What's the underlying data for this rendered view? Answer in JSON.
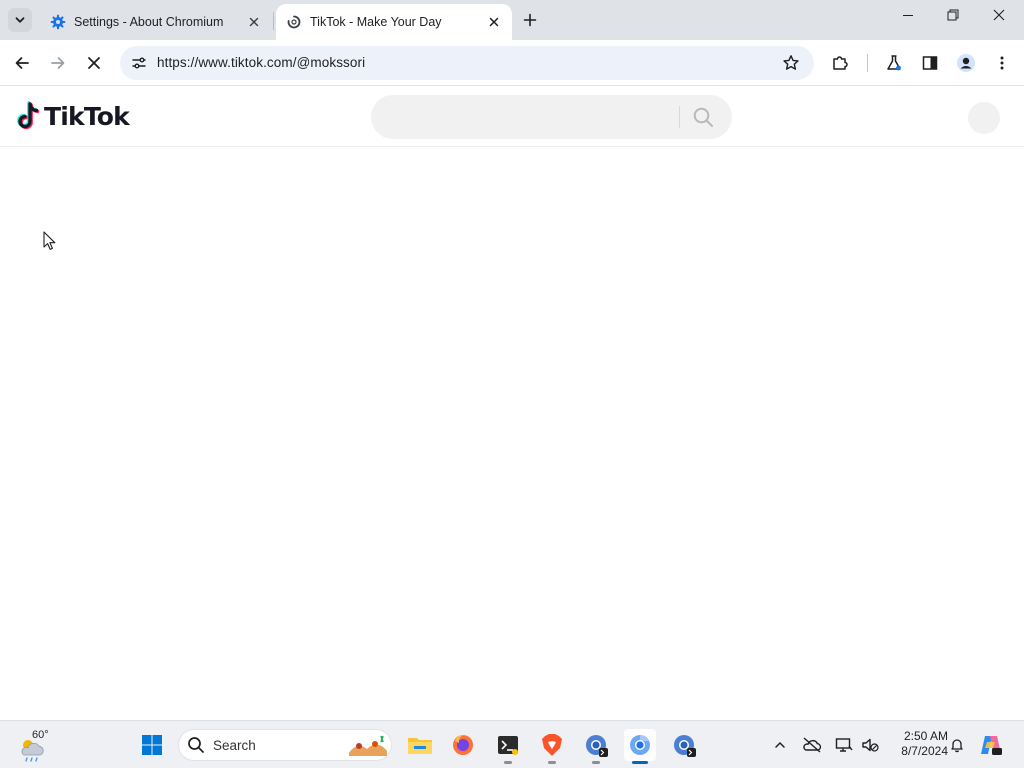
{
  "browser": {
    "tabs": [
      {
        "title": "Settings - About Chromium",
        "favicon": "gear-icon",
        "active": false
      },
      {
        "title": "TikTok - Make Your Day",
        "favicon": "loading-spinner-icon",
        "active": true
      }
    ],
    "address_bar": {
      "url": "https://www.tiktok.com/@mokssori"
    },
    "page_loading": true
  },
  "page": {
    "logo_text": "TikTok",
    "brand_colors": {
      "cyan": "#25f4ee",
      "red": "#fe2c55",
      "dark": "#161823"
    }
  },
  "taskbar": {
    "weather": {
      "temperature": "60°"
    },
    "search": {
      "placeholder": "Search"
    },
    "apps": [
      "start-icon",
      "file-explorer-icon",
      "firefox-icon",
      "terminal-icon",
      "brave-icon",
      "chromium-dev-icon",
      "chromium-icon",
      "chromium-canary-icon"
    ],
    "clock": {
      "time": "2:50 AM",
      "date": "8/7/2024"
    },
    "accent_color": "#0067c0"
  }
}
